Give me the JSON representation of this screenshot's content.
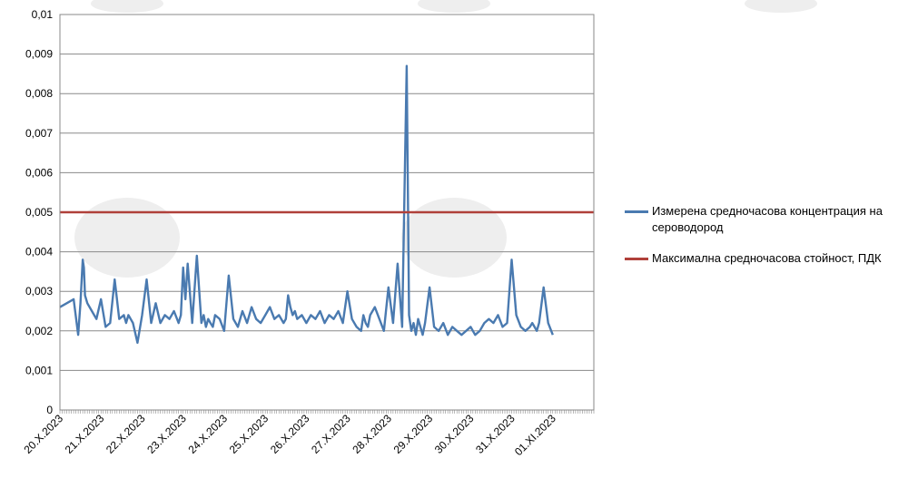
{
  "chart_data": {
    "type": "line",
    "title": "",
    "xlabel": "",
    "ylabel": "",
    "ylim": [
      0,
      0.01
    ],
    "y_ticks": [
      "0",
      "0,001",
      "0,002",
      "0,003",
      "0,004",
      "0,005",
      "0,006",
      "0,007",
      "0,008",
      "0,009",
      "0,01"
    ],
    "x_ticks": [
      "20.X.2023",
      "21.X.2023",
      "22.X.2023",
      "23.X.2023",
      "24.X.2023",
      "25.X.2023",
      "26.X.2023",
      "27.X.2023",
      "28.X.2023",
      "29.X.2023",
      "30.X.2023",
      "31.X.2023",
      "01.XI.2023"
    ],
    "grid": "horizontal",
    "legend_position": "right",
    "series": [
      {
        "name": "Измерена средночасова концентрация на сероводород",
        "color": "#4a7ab0",
        "x_hours": [
          0,
          6,
          12,
          16,
          18,
          20,
          21,
          22,
          24,
          28,
          32,
          36,
          40,
          44,
          48,
          52,
          56,
          58,
          60,
          62,
          64,
          68,
          72,
          76,
          80,
          84,
          88,
          92,
          96,
          100,
          104,
          106,
          108,
          110,
          112,
          116,
          120,
          124,
          126,
          128,
          130,
          132,
          134,
          136,
          140,
          144,
          148,
          152,
          156,
          160,
          164,
          168,
          172,
          176,
          180,
          184,
          188,
          192,
          196,
          198,
          200,
          202,
          204,
          206,
          208,
          212,
          216,
          220,
          224,
          228,
          232,
          236,
          240,
          244,
          248,
          252,
          256,
          260,
          264,
          266,
          268,
          270,
          272,
          276,
          280,
          284,
          288,
          292,
          296,
          300,
          304,
          306,
          308,
          310,
          312,
          314,
          316,
          318,
          320,
          324,
          328,
          332,
          336,
          340,
          344,
          348,
          352,
          356,
          360,
          364,
          368,
          372,
          376,
          380,
          384,
          388,
          392,
          396,
          400,
          404,
          408,
          412,
          414,
          416,
          418,
          420,
          424,
          428,
          432,
          436,
          440,
          444,
          448,
          452,
          456,
          460
        ],
        "values": [
          0.0026,
          0.0027,
          0.0028,
          0.0019,
          0.0027,
          0.0038,
          0.0036,
          0.0029,
          0.0027,
          0.0025,
          0.0023,
          0.0028,
          0.0021,
          0.0022,
          0.0033,
          0.0023,
          0.0024,
          0.0022,
          0.0024,
          0.0023,
          0.0022,
          0.0017,
          0.0024,
          0.0033,
          0.0022,
          0.0027,
          0.0022,
          0.0024,
          0.0023,
          0.0025,
          0.0022,
          0.0024,
          0.0036,
          0.0028,
          0.0037,
          0.0022,
          0.0039,
          0.0022,
          0.0024,
          0.0021,
          0.0023,
          0.0022,
          0.0021,
          0.0024,
          0.0023,
          0.002,
          0.0034,
          0.0023,
          0.0021,
          0.0025,
          0.0022,
          0.0026,
          0.0023,
          0.0022,
          0.0024,
          0.0026,
          0.0023,
          0.0024,
          0.0022,
          0.0023,
          0.0029,
          0.0026,
          0.0024,
          0.0025,
          0.0023,
          0.0024,
          0.0022,
          0.0024,
          0.0023,
          0.0025,
          0.0022,
          0.0024,
          0.0023,
          0.0025,
          0.0022,
          0.003,
          0.0023,
          0.0021,
          0.002,
          0.0024,
          0.0022,
          0.0021,
          0.0024,
          0.0026,
          0.0023,
          0.002,
          0.0031,
          0.0022,
          0.0037,
          0.0021,
          0.0087,
          0.0024,
          0.002,
          0.0022,
          0.0019,
          0.0023,
          0.0021,
          0.0019,
          0.0022,
          0.0031,
          0.0021,
          0.002,
          0.0022,
          0.0019,
          0.0021,
          0.002,
          0.0019,
          0.002,
          0.0021,
          0.0019,
          0.002,
          0.0022,
          0.0023,
          0.0022,
          0.0024,
          0.0021,
          0.0022,
          0.0038,
          0.0024,
          0.0021,
          0.002,
          0.0021,
          0.0022,
          0.0021,
          0.002,
          0.0022,
          0.0031,
          0.0022,
          0.0019
        ]
      },
      {
        "name": "Максимална средночасова стойност, ПДК",
        "color": "#b0403a",
        "x_hours": [
          0,
          468
        ],
        "values": [
          0.005,
          0.005
        ]
      }
    ]
  }
}
